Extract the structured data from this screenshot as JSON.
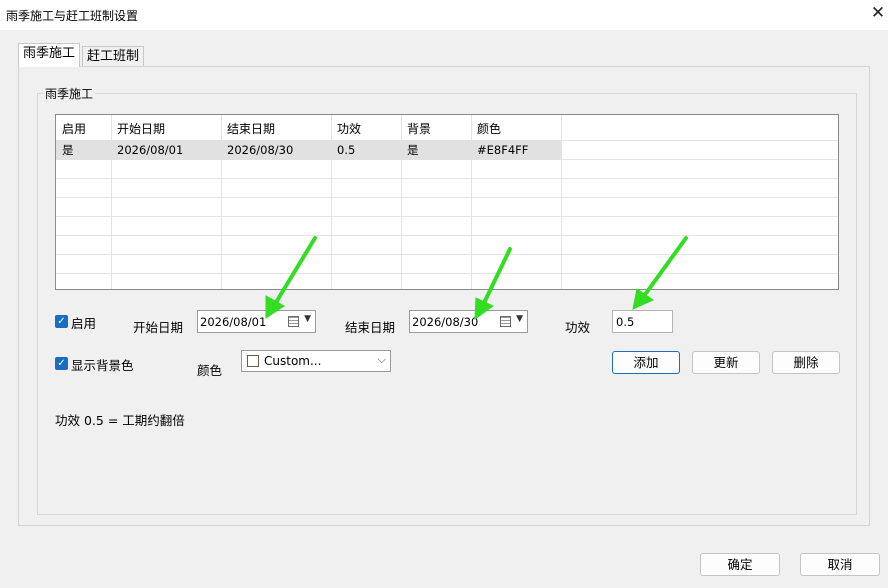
{
  "window": {
    "title": "雨季施工与赶工班制设置",
    "close_glyph": "✕"
  },
  "tabs": [
    {
      "label": "雨季施工",
      "active": true
    },
    {
      "label": "赶工班制",
      "active": false
    }
  ],
  "group": {
    "title": "雨季施工"
  },
  "table": {
    "columns": [
      "启用",
      "开始日期",
      "结束日期",
      "功效",
      "背景",
      "颜色"
    ],
    "rows": [
      [
        "是",
        "2026/08/01",
        "2026/08/30",
        "0.5",
        "是",
        "#E8F4FF"
      ]
    ]
  },
  "form": {
    "enable_label": "启用",
    "enable_checked": true,
    "start_label": "开始日期",
    "start_value": "2026/08/01",
    "end_label": "结束日期",
    "end_value": "2026/08/30",
    "efficiency_label": "功效",
    "efficiency_value": "0.5",
    "bg_label": "显示背景色",
    "bg_checked": true,
    "color_label": "颜色",
    "color_value": "Custom...",
    "add_btn": "添加",
    "update_btn": "更新",
    "delete_btn": "删除",
    "note": "功效 0.5 = 工期约翻倍"
  },
  "footer": {
    "ok_btn": "确定",
    "cancel_btn": "取消"
  },
  "colors": {
    "accent": "#1a6ec1",
    "arrow": "#33dd22",
    "selected_row": "#e1e1e1"
  },
  "icons": [
    "close-icon",
    "calendar-icon",
    "dropdown-arrow-icon",
    "chevron-down-icon",
    "checkmark-icon"
  ]
}
